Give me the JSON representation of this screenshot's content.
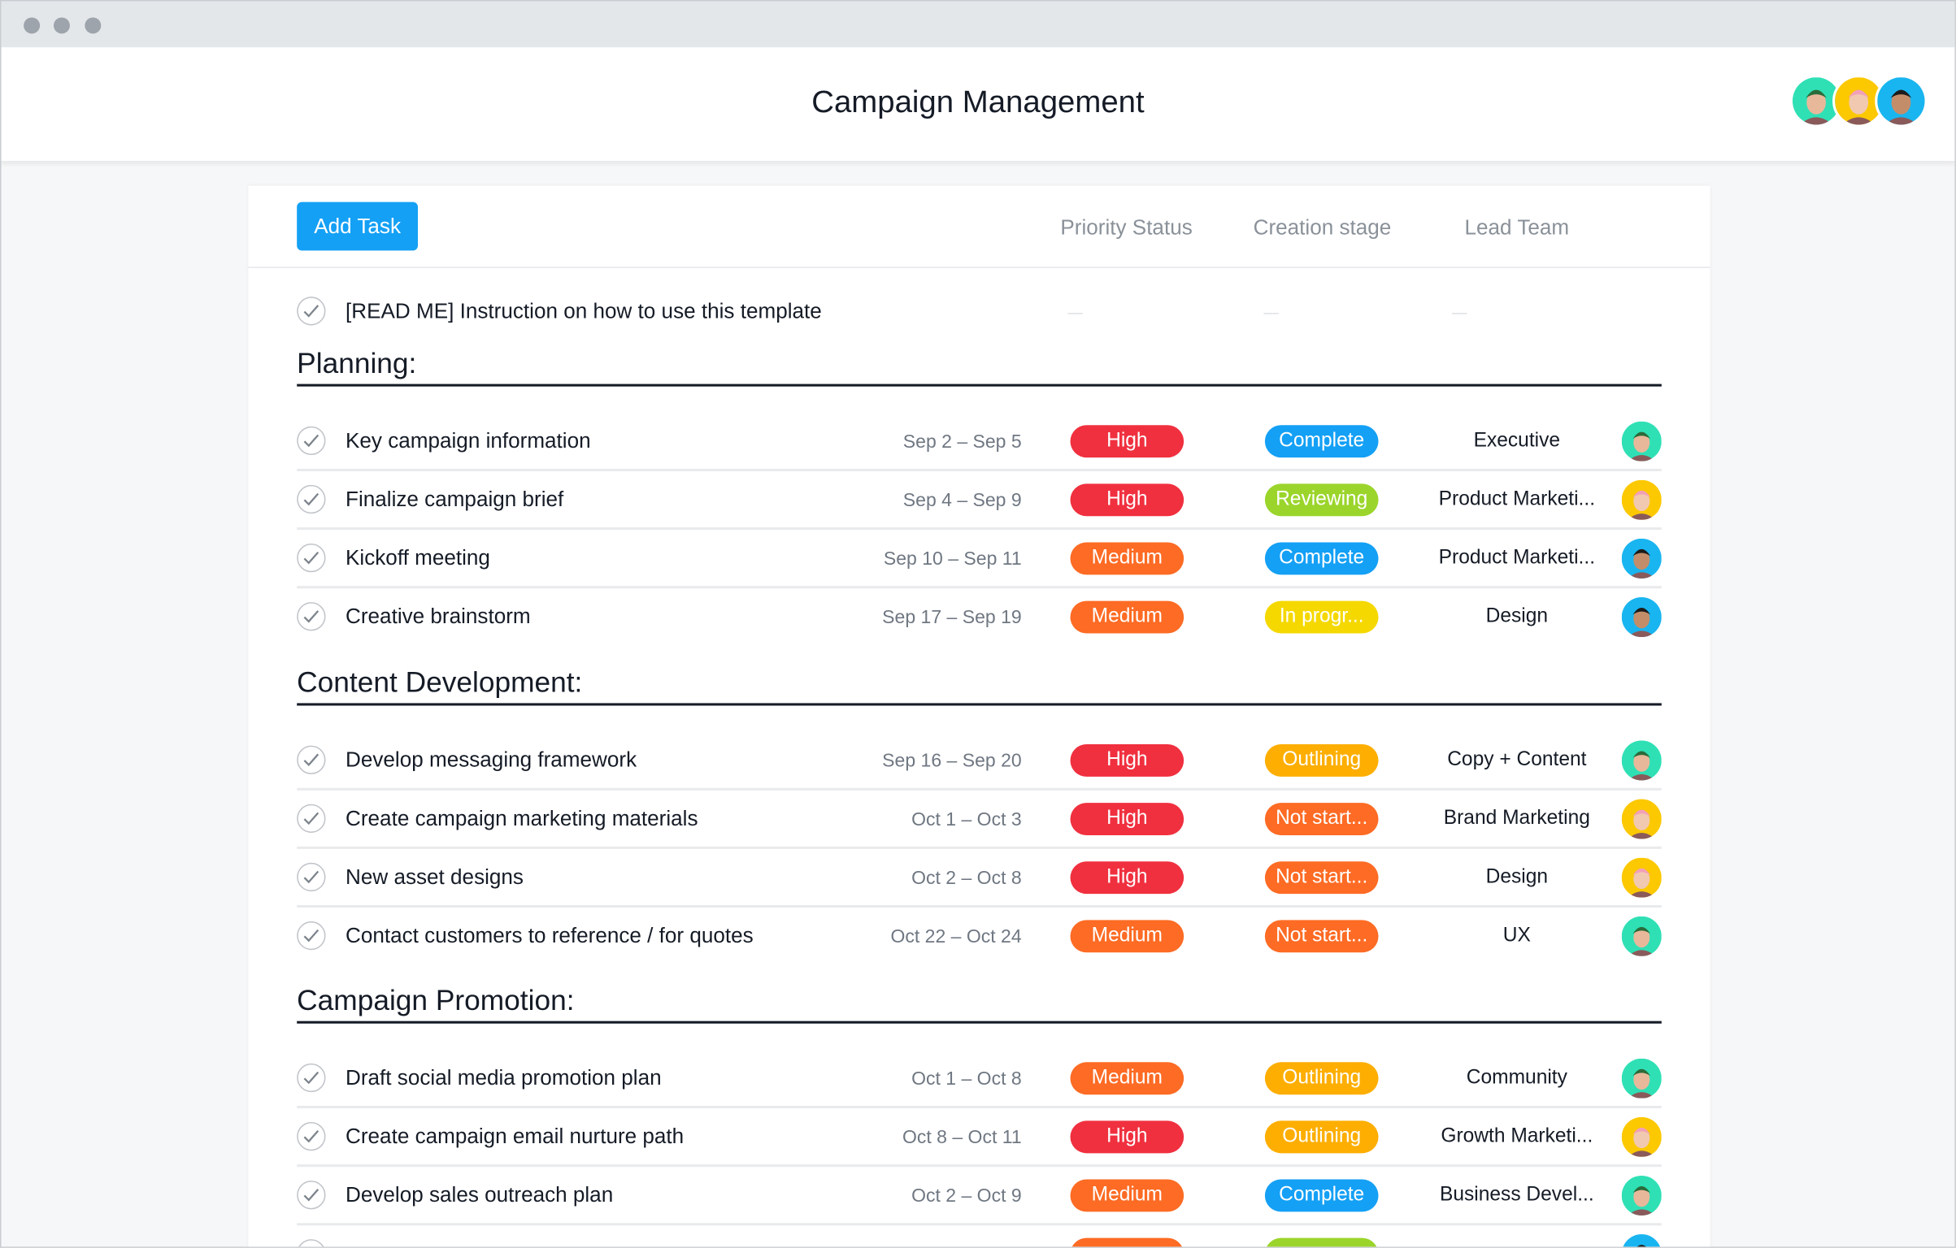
{
  "window": {
    "title": "Campaign Management"
  },
  "header_avatars": [
    "person-green-cap",
    "person-pink-hair",
    "person-glasses"
  ],
  "toolbar": {
    "add_task_label": "Add Task"
  },
  "columns": [
    "Priority Status",
    "Creation stage",
    "Lead Team"
  ],
  "readme": {
    "name": "[READ ME] Instruction on how to use this template",
    "empty_marker": "—"
  },
  "colors": {
    "High": "#f0303f",
    "Medium": "#fd6b24",
    "Complete": "#14a0f5",
    "Reviewing": "#9bd52b",
    "In progr...": "#f5d800",
    "Outlining": "#fdae00",
    "Not start...": "#fd6b24",
    "accent": "#14a0f5"
  },
  "avatar_colors": {
    "teal": "#2fe0b5",
    "yellow": "#fcc800",
    "blue": "#19b5f0"
  },
  "sections": [
    {
      "title": "Planning:",
      "rows": [
        {
          "name": "Key campaign information",
          "dates": "Sep 2 – Sep 5",
          "priority": "High",
          "stage": "Complete",
          "team": "Executive",
          "avatar": "teal"
        },
        {
          "name": "Finalize campaign brief",
          "dates": "Sep 4 – Sep 9",
          "priority": "High",
          "stage": "Reviewing",
          "team": "Product Marketi...",
          "avatar": "yellow"
        },
        {
          "name": "Kickoff meeting",
          "dates": "Sep 10 – Sep 11",
          "priority": "Medium",
          "stage": "Complete",
          "team": "Product Marketi...",
          "avatar": "blue"
        },
        {
          "name": "Creative brainstorm",
          "dates": "Sep 17 – Sep 19",
          "priority": "Medium",
          "stage": "In progr...",
          "team": "Design",
          "avatar": "blue"
        }
      ]
    },
    {
      "title": "Content Development:",
      "rows": [
        {
          "name": "Develop messaging framework",
          "dates": "Sep 16 – Sep 20",
          "priority": "High",
          "stage": "Outlining",
          "team": "Copy + Content",
          "avatar": "teal"
        },
        {
          "name": "Create campaign marketing materials",
          "dates": "Oct 1 – Oct 3",
          "priority": "High",
          "stage": "Not start...",
          "team": "Brand Marketing",
          "avatar": "yellow"
        },
        {
          "name": "New asset designs",
          "dates": "Oct 2 – Oct 8",
          "priority": "High",
          "stage": "Not start...",
          "team": "Design",
          "avatar": "yellow"
        },
        {
          "name": "Contact customers to reference / for quotes",
          "dates": "Oct 22 – Oct 24",
          "priority": "Medium",
          "stage": "Not start...",
          "team": "UX",
          "avatar": "teal"
        }
      ]
    },
    {
      "title": "Campaign Promotion:",
      "rows": [
        {
          "name": "Draft social media promotion plan",
          "dates": "Oct 1 – Oct 8",
          "priority": "Medium",
          "stage": "Outlining",
          "team": "Community",
          "avatar": "teal"
        },
        {
          "name": "Create campaign email nurture path",
          "dates": "Oct 8 – Oct 11",
          "priority": "High",
          "stage": "Outlining",
          "team": "Growth Marketi...",
          "avatar": "yellow"
        },
        {
          "name": "Develop sales outreach plan",
          "dates": "Oct 2 – Oct 9",
          "priority": "Medium",
          "stage": "Complete",
          "team": "Business Devel...",
          "avatar": "teal"
        },
        {
          "partial": true,
          "priority_color": "#fd6b24",
          "stage_color": "#9bd52b",
          "avatar": "blue"
        }
      ]
    }
  ]
}
